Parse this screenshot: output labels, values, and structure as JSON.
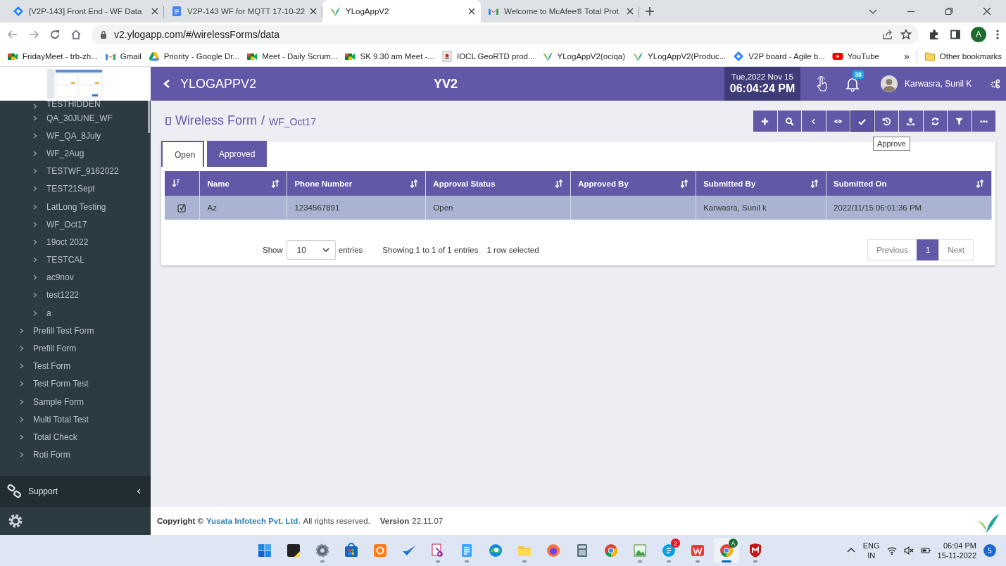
{
  "browser": {
    "tabs": [
      {
        "title": "[V2P-143] Front End - WF Data",
        "kind": "jira",
        "selected": false
      },
      {
        "title": "V2P-143 WF for MQTT 17-10-22",
        "kind": "doc",
        "selected": false
      },
      {
        "title": "YLogAppV2",
        "kind": "leaf",
        "selected": true
      },
      {
        "title": "Welcome to McAfee® Total Prot",
        "kind": "gmail",
        "selected": false
      }
    ],
    "url": "v2.ylogapp.com/#/wirelessForms/data",
    "profile": "A",
    "bookmarks": [
      {
        "label": "FridayMeet - trb-zh...",
        "kind": "meet"
      },
      {
        "label": "Gmail",
        "kind": "gmail"
      },
      {
        "label": "Priority - Google Dr...",
        "kind": "drive"
      },
      {
        "label": "Meet - Daily Scrum...",
        "kind": "meet"
      },
      {
        "label": "SK 9.30 am Meet -...",
        "kind": "meet"
      },
      {
        "label": "IOCL GeoRTD prod...",
        "kind": "page"
      },
      {
        "label": "YLogAppV2(ociqa)",
        "kind": "leaf"
      },
      {
        "label": "YLogAppV2(Produc...",
        "kind": "leaf"
      },
      {
        "label": "V2P board - Agile b...",
        "kind": "jira"
      },
      {
        "label": "YouTube",
        "kind": "youtube"
      }
    ],
    "more": "»",
    "other": "Other bookmarks"
  },
  "header": {
    "app_name": "YLOGAPPV2",
    "center_title": "YV2",
    "date": "Tue,2022 Nov 15",
    "time": "06:04:24 PM",
    "notifications": "38",
    "user": "Karwasra, Sunil K"
  },
  "sidebar": {
    "form_group": {
      "children": [
        {
          "label": "TESTHIDDEN"
        },
        {
          "label": "QA_30JUNE_WF"
        },
        {
          "label": "WF_QA_8July"
        },
        {
          "label": "WF_2Aug"
        },
        {
          "label": "TESTWF_9162022"
        },
        {
          "label": "TEST21Sept"
        },
        {
          "label": "LatLong Testing"
        },
        {
          "label": "WF_Oct17"
        },
        {
          "label": "19oct 2022"
        },
        {
          "label": "TESTCAL"
        },
        {
          "label": "ac9nov"
        },
        {
          "label": "test1222"
        },
        {
          "label": "a"
        }
      ]
    },
    "forms": [
      {
        "label": "Prefill Test Form"
      },
      {
        "label": "Prefill Form"
      },
      {
        "label": "Test Form"
      },
      {
        "label": "Test Form Test"
      },
      {
        "label": "Sample Form"
      },
      {
        "label": "Multi Total Test"
      },
      {
        "label": "Total Check"
      },
      {
        "label": "Roti Form"
      }
    ],
    "support": "Support"
  },
  "page": {
    "title": "Wireless Form",
    "separator": "/",
    "subtitle": "WF_Oct17",
    "toolbar": [
      {
        "kind": "add",
        "focused": false
      },
      {
        "kind": "search",
        "focused": false
      },
      {
        "kind": "back",
        "focused": false
      },
      {
        "kind": "view",
        "focused": false
      },
      {
        "kind": "approve",
        "focused": true
      },
      {
        "kind": "history",
        "focused": false
      },
      {
        "kind": "upload",
        "focused": false
      },
      {
        "kind": "refresh",
        "focused": false
      },
      {
        "kind": "filter",
        "focused": false
      },
      {
        "kind": "more",
        "focused": false
      }
    ],
    "tooltip": "Approve",
    "tabs": [
      {
        "label": "Open",
        "selected": true
      },
      {
        "label": "Approved",
        "selected": false
      }
    ],
    "table": {
      "columns": [
        "Name",
        "Phone Number",
        "Approval Status",
        "Approved By",
        "Submitted By",
        "Submitted On"
      ],
      "rows": [
        {
          "selected": true,
          "cells": [
            "Az",
            "1234567891",
            "Open",
            "",
            "Karwasra, Sunil k",
            "2022/11/15 06:01:36 PM"
          ]
        }
      ]
    },
    "show_label": "Show",
    "page_length": "10",
    "entries_label": "entries",
    "info": "Showing 1 to 1 of 1 entries",
    "selection_info": "1 row selected",
    "pagination": [
      {
        "label": "Previous",
        "selected": false
      },
      {
        "label": "1",
        "selected": true
      },
      {
        "label": "Next",
        "selected": false
      }
    ]
  },
  "footer": {
    "copyright": "Copyright ©",
    "company": "Yusata Infotech Pvt. Ltd.",
    "rights": "All rights reserved.",
    "version_label": "Version",
    "version": "22.11.07"
  },
  "taskbar": {
    "skype_badge": "2",
    "chrome_profile": "A",
    "language": "ENG",
    "region": "IN",
    "time": "06:04 PM",
    "date": "15-11-2022",
    "notification_count": "5"
  }
}
